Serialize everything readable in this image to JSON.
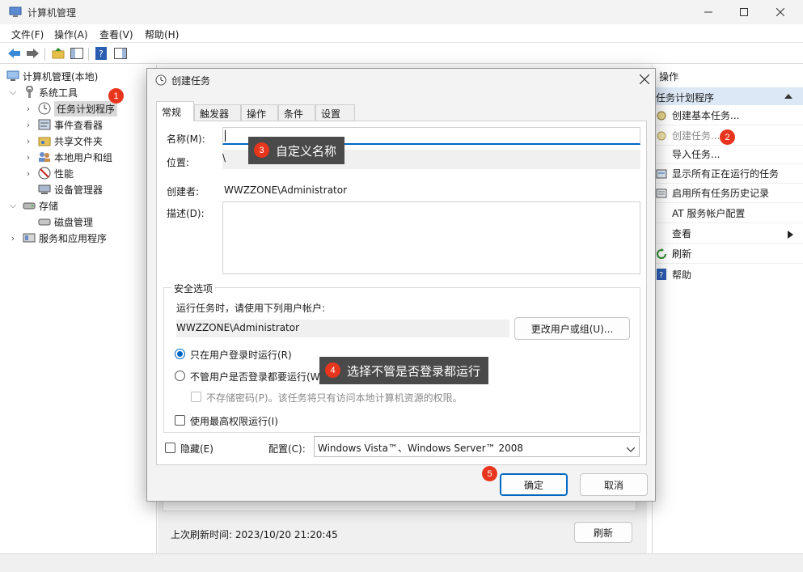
{
  "app": {
    "title": "计算机管理",
    "menu": [
      "文件(F)",
      "操作(A)",
      "查看(V)",
      "帮助(H)"
    ]
  },
  "tree": {
    "items": [
      {
        "label": "计算机管理(本地)",
        "icon": "computer-icon"
      },
      {
        "label": "系统工具",
        "icon": "tools-icon"
      },
      {
        "label": "任务计划程序",
        "icon": "clock-icon"
      },
      {
        "label": "事件查看器",
        "icon": "event-viewer-icon"
      },
      {
        "label": "共享文件夹",
        "icon": "shared-folder-icon"
      },
      {
        "label": "本地用户和组",
        "icon": "users-icon"
      },
      {
        "label": "性能",
        "icon": "performance-icon"
      },
      {
        "label": "设备管理器",
        "icon": "device-manager-icon"
      },
      {
        "label": "存储",
        "icon": "storage-icon"
      },
      {
        "label": "磁盘管理",
        "icon": "disk-icon"
      },
      {
        "label": "服务和应用程序",
        "icon": "services-icon"
      }
    ]
  },
  "actions": {
    "header": "操作",
    "section": "任务计划程序",
    "items": [
      {
        "label": "创建基本任务...",
        "icon": "basic-task-icon"
      },
      {
        "label": "创建任务...",
        "icon": "create-task-icon"
      },
      {
        "label": "导入任务...",
        "icon": ""
      },
      {
        "label": "显示所有正在运行的任务",
        "icon": "running-tasks-icon"
      },
      {
        "label": "启用所有任务历史记录",
        "icon": "history-icon"
      },
      {
        "label": "AT 服务帐户配置",
        "icon": ""
      },
      {
        "label": "查看",
        "icon": ""
      },
      {
        "label": "刷新",
        "icon": "refresh-icon"
      },
      {
        "label": "帮助",
        "icon": "help-icon"
      }
    ]
  },
  "center": {
    "last_refresh": "上次刷新时间: 2023/10/20 21:20:45",
    "refresh_label": "刷新"
  },
  "dialog": {
    "title": "创建任务",
    "tabs": [
      "常规",
      "触发器",
      "操作",
      "条件",
      "设置"
    ],
    "name_label": "名称(M):",
    "name_value": "",
    "location_label": "位置:",
    "location_value": "\\",
    "author_label": "创建者:",
    "author_value": "WWZZONE\\Administrator",
    "description_label": "描述(D):",
    "description_value": "",
    "security": {
      "title": "安全选项",
      "run_as_label": "运行任务时，请使用下列用户帐户:",
      "user_account": "WWZZONE\\Administrator",
      "change_user_button": "更改用户或组(U)...",
      "radio_logged_on": "只在用户登录时运行(R)",
      "radio_whether_logged": "不管用户是否登录都要运行(W)",
      "no_store_password": "不存储密码(P)。该任务将只有访问本地计算机资源的权限。",
      "highest_privileges": "使用最高权限运行(I)",
      "selected_radio": "只在用户登录时运行(R)"
    },
    "hidden_label": "隐藏(E)",
    "configure_label": "配置(C):",
    "configure_value": "Windows Vista™、Windows Server™ 2008",
    "ok_button": "确定",
    "cancel_button": "取消"
  },
  "annotations": {
    "badge1": "1",
    "badge2": "2",
    "badge3": "3",
    "badge4": "4",
    "badge5": "5",
    "tip3": "自定义名称",
    "tip4": "选择不管是否登录都运行"
  },
  "colors": {
    "accent": "#0067c0",
    "badge": "#e8361e",
    "tooltip_bg": "#4a4a4a",
    "selection": "#dde8f6"
  }
}
